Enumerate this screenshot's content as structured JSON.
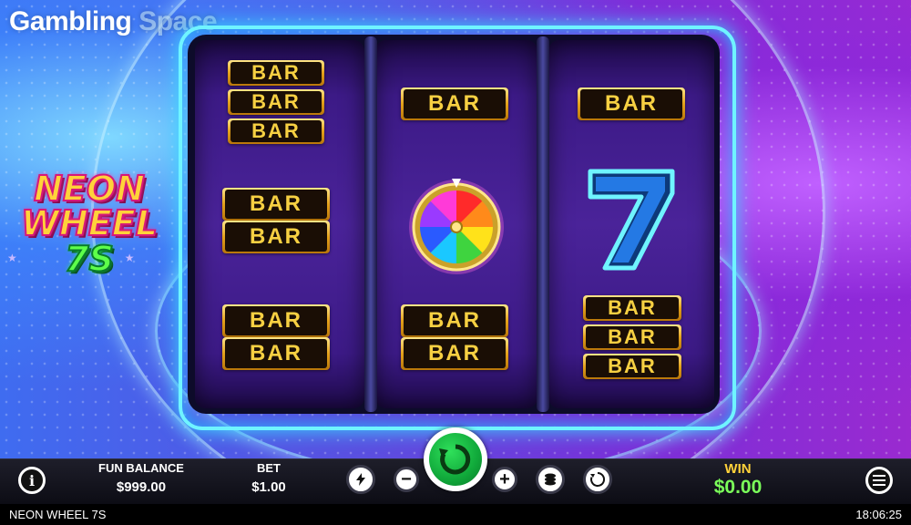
{
  "brand": {
    "word1": "Gambling",
    "word2": "Space"
  },
  "game_logo": {
    "line1": "NEON",
    "line2": "WHEEL",
    "line3": "7S"
  },
  "reels": {
    "reel1": [
      "BAR",
      "BAR",
      "BAR",
      "BAR",
      "BAR",
      "BAR",
      "BAR"
    ],
    "reel2": [
      "BAR",
      "BAR",
      "BAR"
    ],
    "reel3": [
      "BAR",
      "BAR",
      "BAR",
      "BAR"
    ],
    "symbols": {
      "reel2_middle": "wheel-icon",
      "reel3_middle": "seven-icon"
    }
  },
  "controls": {
    "info_icon": "i",
    "balance_label": "FUN BALANCE",
    "balance_value": "$999.00",
    "bet_label": "BET",
    "bet_value": "$1.00",
    "minus_label": "−",
    "plus_label": "+",
    "win_label": "WIN",
    "win_value": "$0.00"
  },
  "status": {
    "game_title": "NEON WHEEL 7S",
    "clock": "18:06:25"
  },
  "colors": {
    "accent_gold": "#f7d042",
    "spin_green": "#10a83a",
    "win_green": "#7bff5a",
    "frame_cyan": "#6ff4ff"
  }
}
